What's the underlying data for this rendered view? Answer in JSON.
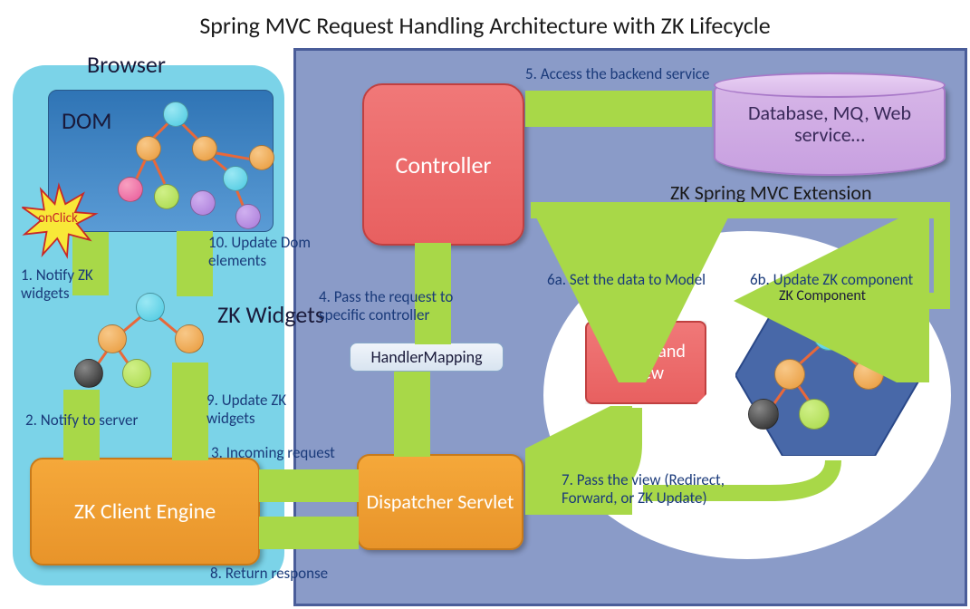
{
  "title": "Spring MVC Request Handling Architecture with ZK Lifecycle",
  "browser": {
    "label": "Browser",
    "dom_label": "DOM",
    "zk_widgets_label": "ZK Widgets",
    "client_engine": "ZK Client Engine",
    "event": "onClick"
  },
  "server": {
    "controller": "Controller",
    "handler_mapping": "HandlerMapping",
    "dispatcher": "Dispatcher Servlet",
    "model_view": "Model and View",
    "database": "Database, MQ, Web service…",
    "extension_label": "ZK Spring MVC Extension",
    "zk_component": "ZK Component"
  },
  "steps": {
    "s1": "1. Notify ZK widgets",
    "s2": "2. Notify to server",
    "s3": "3. Incoming request",
    "s4": "4. Pass the request to specific controller",
    "s5": "5. Access the backend service",
    "s6a": "6a. Set the data to Model",
    "s6b": "6b. Update ZK component",
    "s7": "7. Pass the view (Redirect, Forward, or ZK Update)",
    "s8": "8. Return response",
    "s9": "9. Update ZK widgets",
    "s10": "10. Update Dom elements"
  }
}
